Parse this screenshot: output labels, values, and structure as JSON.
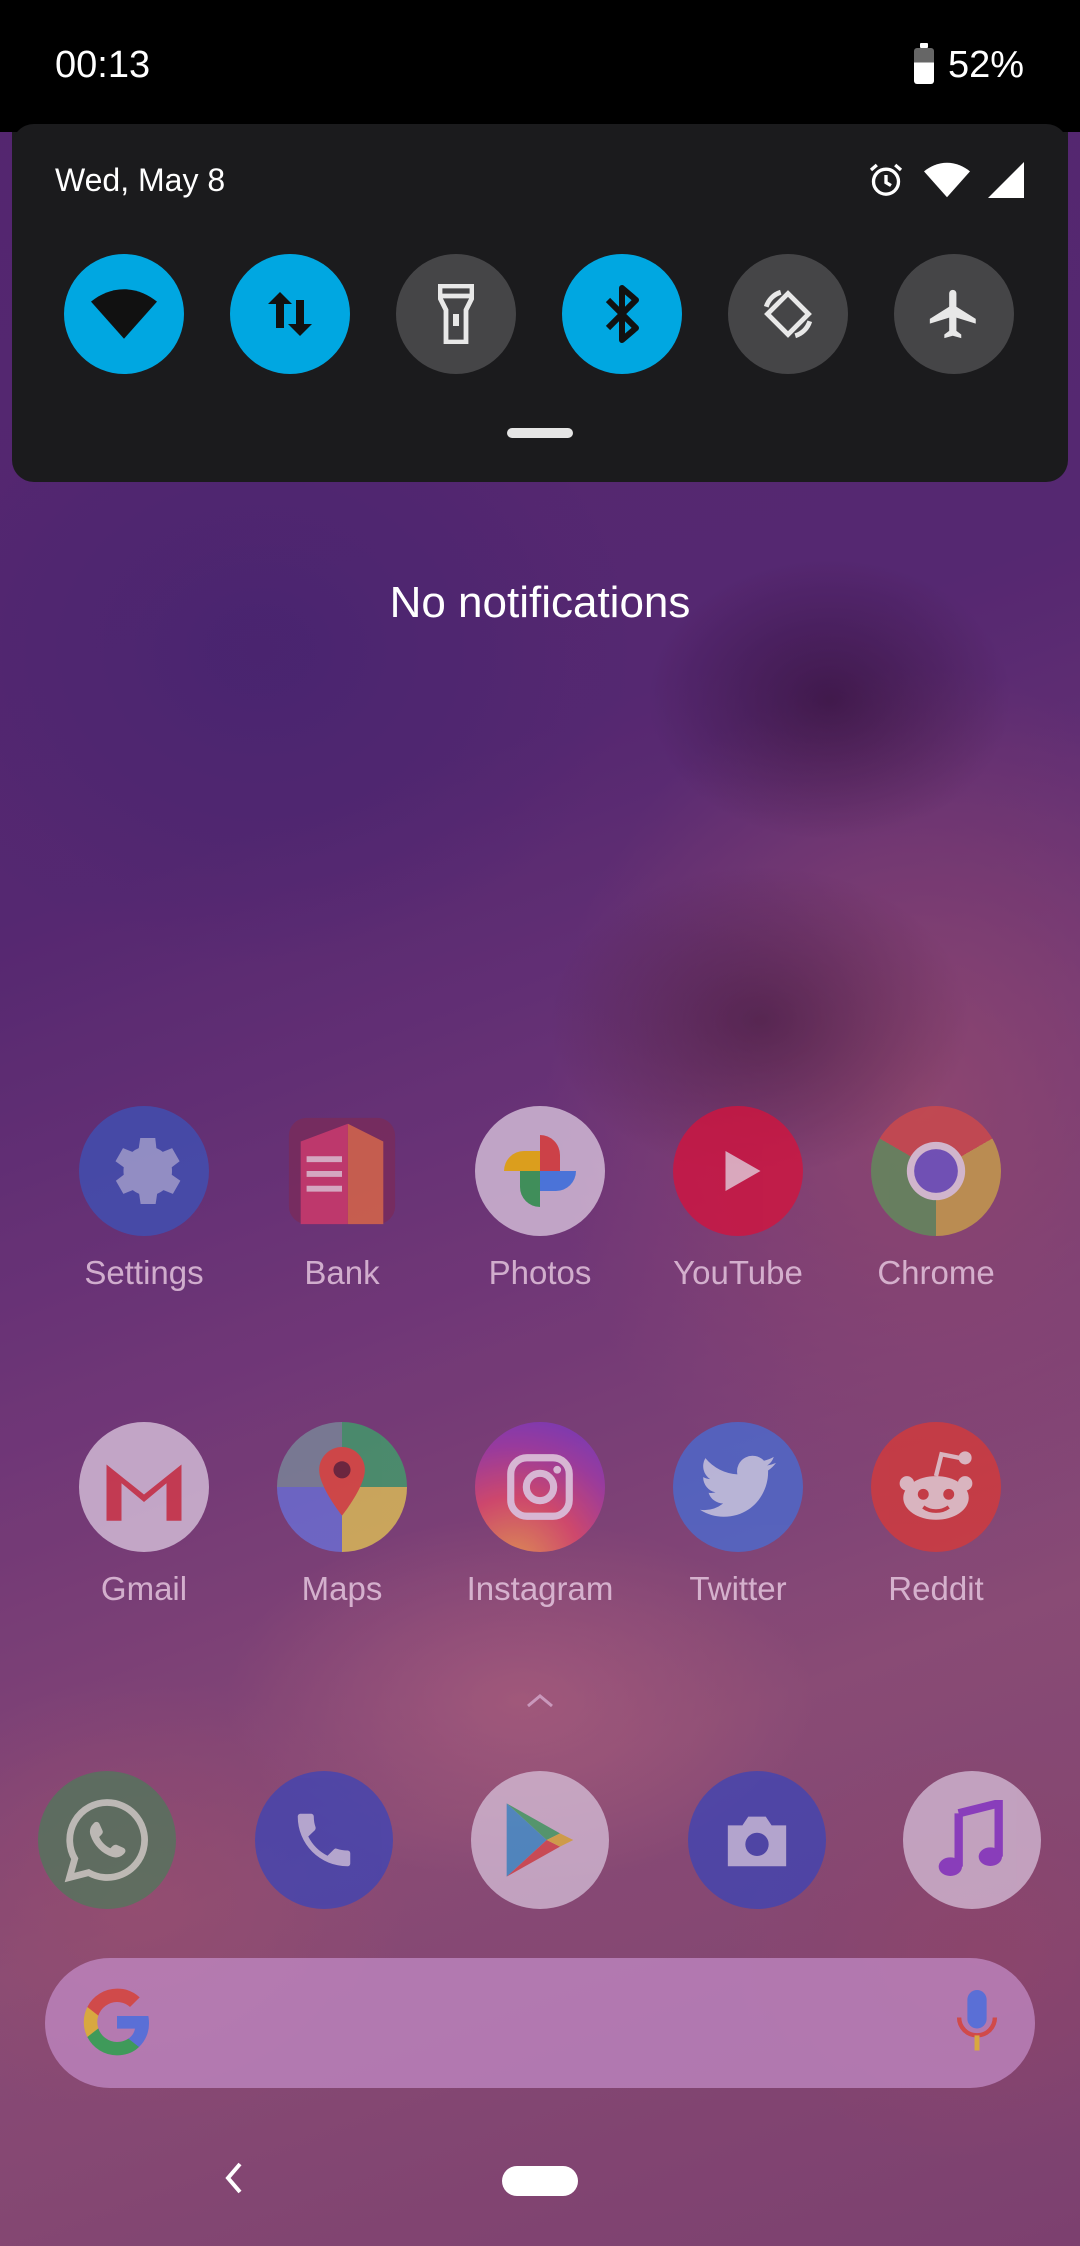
{
  "status_bar": {
    "time": "00:13",
    "battery": "52%"
  },
  "quick_settings": {
    "date": "Wed, May 8",
    "tiles": [
      {
        "name": "Wi-Fi",
        "icon": "wifi-icon",
        "state": "on"
      },
      {
        "name": "Mobile data",
        "icon": "data-arrows-icon",
        "state": "on"
      },
      {
        "name": "Flashlight",
        "icon": "flashlight-icon",
        "state": "off"
      },
      {
        "name": "Bluetooth",
        "icon": "bluetooth-icon",
        "state": "on"
      },
      {
        "name": "Auto-rotate",
        "icon": "rotate-icon",
        "state": "off"
      },
      {
        "name": "Airplane mode",
        "icon": "airplane-icon",
        "state": "off"
      }
    ],
    "accent_color": "#00a7e1"
  },
  "notifications": {
    "empty_text": "No notifications"
  },
  "home": {
    "row1": [
      "Settings",
      "Bank",
      "Photos",
      "YouTube",
      "Chrome"
    ],
    "row2": [
      "Gmail",
      "Maps",
      "Instagram",
      "Twitter",
      "Reddit"
    ],
    "dock": [
      "WhatsApp",
      "Phone",
      "Play Store",
      "Camera",
      "Music"
    ]
  }
}
